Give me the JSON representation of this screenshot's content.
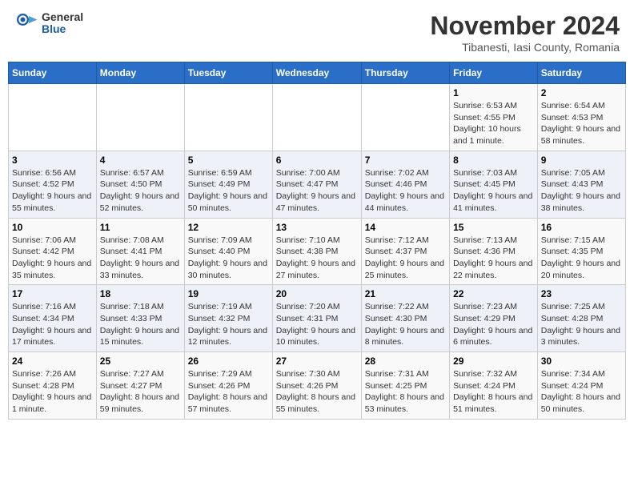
{
  "logo": {
    "general": "General",
    "blue": "Blue"
  },
  "title": "November 2024",
  "location": "Tibanesti, Iasi County, Romania",
  "days_header": [
    "Sunday",
    "Monday",
    "Tuesday",
    "Wednesday",
    "Thursday",
    "Friday",
    "Saturday"
  ],
  "weeks": [
    [
      {
        "day": "",
        "info": ""
      },
      {
        "day": "",
        "info": ""
      },
      {
        "day": "",
        "info": ""
      },
      {
        "day": "",
        "info": ""
      },
      {
        "day": "",
        "info": ""
      },
      {
        "day": "1",
        "info": "Sunrise: 6:53 AM\nSunset: 4:55 PM\nDaylight: 10 hours and 1 minute."
      },
      {
        "day": "2",
        "info": "Sunrise: 6:54 AM\nSunset: 4:53 PM\nDaylight: 9 hours and 58 minutes."
      }
    ],
    [
      {
        "day": "3",
        "info": "Sunrise: 6:56 AM\nSunset: 4:52 PM\nDaylight: 9 hours and 55 minutes."
      },
      {
        "day": "4",
        "info": "Sunrise: 6:57 AM\nSunset: 4:50 PM\nDaylight: 9 hours and 52 minutes."
      },
      {
        "day": "5",
        "info": "Sunrise: 6:59 AM\nSunset: 4:49 PM\nDaylight: 9 hours and 50 minutes."
      },
      {
        "day": "6",
        "info": "Sunrise: 7:00 AM\nSunset: 4:47 PM\nDaylight: 9 hours and 47 minutes."
      },
      {
        "day": "7",
        "info": "Sunrise: 7:02 AM\nSunset: 4:46 PM\nDaylight: 9 hours and 44 minutes."
      },
      {
        "day": "8",
        "info": "Sunrise: 7:03 AM\nSunset: 4:45 PM\nDaylight: 9 hours and 41 minutes."
      },
      {
        "day": "9",
        "info": "Sunrise: 7:05 AM\nSunset: 4:43 PM\nDaylight: 9 hours and 38 minutes."
      }
    ],
    [
      {
        "day": "10",
        "info": "Sunrise: 7:06 AM\nSunset: 4:42 PM\nDaylight: 9 hours and 35 minutes."
      },
      {
        "day": "11",
        "info": "Sunrise: 7:08 AM\nSunset: 4:41 PM\nDaylight: 9 hours and 33 minutes."
      },
      {
        "day": "12",
        "info": "Sunrise: 7:09 AM\nSunset: 4:40 PM\nDaylight: 9 hours and 30 minutes."
      },
      {
        "day": "13",
        "info": "Sunrise: 7:10 AM\nSunset: 4:38 PM\nDaylight: 9 hours and 27 minutes."
      },
      {
        "day": "14",
        "info": "Sunrise: 7:12 AM\nSunset: 4:37 PM\nDaylight: 9 hours and 25 minutes."
      },
      {
        "day": "15",
        "info": "Sunrise: 7:13 AM\nSunset: 4:36 PM\nDaylight: 9 hours and 22 minutes."
      },
      {
        "day": "16",
        "info": "Sunrise: 7:15 AM\nSunset: 4:35 PM\nDaylight: 9 hours and 20 minutes."
      }
    ],
    [
      {
        "day": "17",
        "info": "Sunrise: 7:16 AM\nSunset: 4:34 PM\nDaylight: 9 hours and 17 minutes."
      },
      {
        "day": "18",
        "info": "Sunrise: 7:18 AM\nSunset: 4:33 PM\nDaylight: 9 hours and 15 minutes."
      },
      {
        "day": "19",
        "info": "Sunrise: 7:19 AM\nSunset: 4:32 PM\nDaylight: 9 hours and 12 minutes."
      },
      {
        "day": "20",
        "info": "Sunrise: 7:20 AM\nSunset: 4:31 PM\nDaylight: 9 hours and 10 minutes."
      },
      {
        "day": "21",
        "info": "Sunrise: 7:22 AM\nSunset: 4:30 PM\nDaylight: 9 hours and 8 minutes."
      },
      {
        "day": "22",
        "info": "Sunrise: 7:23 AM\nSunset: 4:29 PM\nDaylight: 9 hours and 6 minutes."
      },
      {
        "day": "23",
        "info": "Sunrise: 7:25 AM\nSunset: 4:28 PM\nDaylight: 9 hours and 3 minutes."
      }
    ],
    [
      {
        "day": "24",
        "info": "Sunrise: 7:26 AM\nSunset: 4:28 PM\nDaylight: 9 hours and 1 minute."
      },
      {
        "day": "25",
        "info": "Sunrise: 7:27 AM\nSunset: 4:27 PM\nDaylight: 8 hours and 59 minutes."
      },
      {
        "day": "26",
        "info": "Sunrise: 7:29 AM\nSunset: 4:26 PM\nDaylight: 8 hours and 57 minutes."
      },
      {
        "day": "27",
        "info": "Sunrise: 7:30 AM\nSunset: 4:26 PM\nDaylight: 8 hours and 55 minutes."
      },
      {
        "day": "28",
        "info": "Sunrise: 7:31 AM\nSunset: 4:25 PM\nDaylight: 8 hours and 53 minutes."
      },
      {
        "day": "29",
        "info": "Sunrise: 7:32 AM\nSunset: 4:24 PM\nDaylight: 8 hours and 51 minutes."
      },
      {
        "day": "30",
        "info": "Sunrise: 7:34 AM\nSunset: 4:24 PM\nDaylight: 8 hours and 50 minutes."
      }
    ]
  ]
}
